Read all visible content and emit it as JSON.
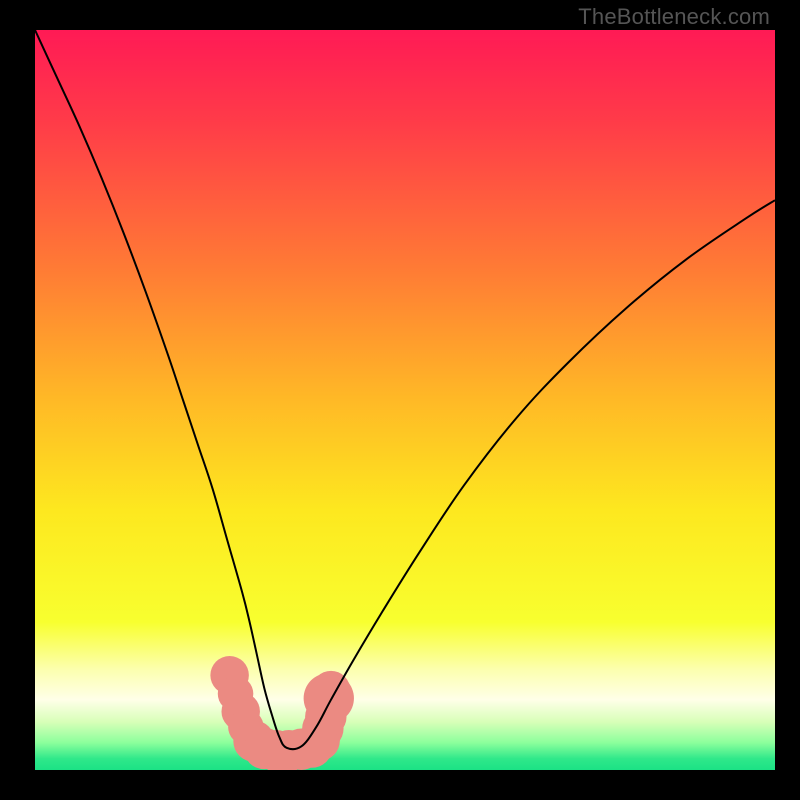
{
  "watermark": "TheBottleneck.com",
  "chart_data": {
    "type": "line",
    "title": "",
    "xlabel": "",
    "ylabel": "",
    "xlim": [
      0,
      100
    ],
    "ylim": [
      0,
      100
    ],
    "background_gradient": {
      "stops": [
        {
          "offset": 0.0,
          "color": "#ff1a55"
        },
        {
          "offset": 0.12,
          "color": "#ff3a49"
        },
        {
          "offset": 0.32,
          "color": "#ff7a35"
        },
        {
          "offset": 0.5,
          "color": "#ffb926"
        },
        {
          "offset": 0.65,
          "color": "#fde81f"
        },
        {
          "offset": 0.8,
          "color": "#f8ff2f"
        },
        {
          "offset": 0.865,
          "color": "#fcffb0"
        },
        {
          "offset": 0.905,
          "color": "#ffffe8"
        },
        {
          "offset": 0.935,
          "color": "#d8ffb8"
        },
        {
          "offset": 0.963,
          "color": "#8cff9c"
        },
        {
          "offset": 0.985,
          "color": "#2fe88a"
        },
        {
          "offset": 1.0,
          "color": "#1be285"
        }
      ]
    },
    "series": [
      {
        "name": "bottleneck-curve",
        "stroke": "#000000",
        "x": [
          0,
          3,
          6,
          9,
          12,
          15,
          18,
          20,
          22,
          24,
          26,
          28,
          29,
          30,
          31,
          32,
          33,
          34,
          36,
          38,
          40,
          43,
          47,
          52,
          58,
          65,
          72,
          80,
          88,
          96,
          100
        ],
        "y": [
          100,
          93.5,
          87,
          80,
          72.5,
          64.5,
          56,
          50,
          44,
          38,
          31,
          24,
          20,
          15.5,
          11,
          7.5,
          4.5,
          3,
          3.2,
          5.8,
          9.5,
          14.8,
          21.5,
          29.5,
          38.5,
          47.5,
          55,
          62.5,
          69,
          74.5,
          77
        ]
      }
    ],
    "markers": {
      "name": "highlight-band",
      "color": "#eb8a82",
      "points": [
        {
          "x": 26.3,
          "y": 12.8,
          "r": 2.6
        },
        {
          "x": 27.1,
          "y": 10.3,
          "r": 2.4
        },
        {
          "x": 27.8,
          "y": 7.9,
          "r": 2.6
        },
        {
          "x": 28.5,
          "y": 5.8,
          "r": 2.4
        },
        {
          "x": 29.6,
          "y": 3.9,
          "r": 2.8
        },
        {
          "x": 31.0,
          "y": 2.9,
          "r": 2.8
        },
        {
          "x": 32.6,
          "y": 2.6,
          "r": 2.8
        },
        {
          "x": 34.3,
          "y": 2.6,
          "r": 2.8
        },
        {
          "x": 36.0,
          "y": 2.8,
          "r": 2.8
        },
        {
          "x": 37.4,
          "y": 3.1,
          "r": 2.8
        },
        {
          "x": 38.4,
          "y": 4.0,
          "r": 2.8
        },
        {
          "x": 38.9,
          "y": 5.6,
          "r": 2.8
        },
        {
          "x": 39.3,
          "y": 7.2,
          "r": 2.8
        },
        {
          "x": 39.7,
          "y": 9.7,
          "r": 3.4
        },
        {
          "x": 40.0,
          "y": 10.8,
          "r": 2.6
        }
      ]
    }
  }
}
